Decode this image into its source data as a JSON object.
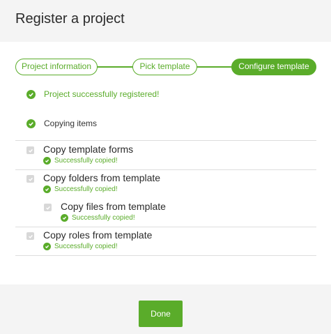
{
  "dialog": {
    "title": "Register a project"
  },
  "stepper": {
    "steps": [
      {
        "label": "Project information",
        "state": "completed"
      },
      {
        "label": "Pick template",
        "state": "completed"
      },
      {
        "label": "Configure template",
        "state": "active"
      }
    ]
  },
  "status": {
    "registered": "Project successfully registered!",
    "copying": "Copying items"
  },
  "tasks": [
    {
      "title": "Copy template forms",
      "status": "Successfully copied!"
    },
    {
      "title": "Copy folders from template",
      "status": "Successfully copied!"
    },
    {
      "title": "Copy files from template",
      "status": "Successfully copied!"
    },
    {
      "title": "Copy roles from template",
      "status": "Successfully copied!"
    }
  ],
  "footer": {
    "done_label": "Done"
  },
  "colors": {
    "accent": "#5aac2a",
    "header_bg": "#f4f4f4",
    "checkbox_disabled": "#d8d8d8"
  }
}
